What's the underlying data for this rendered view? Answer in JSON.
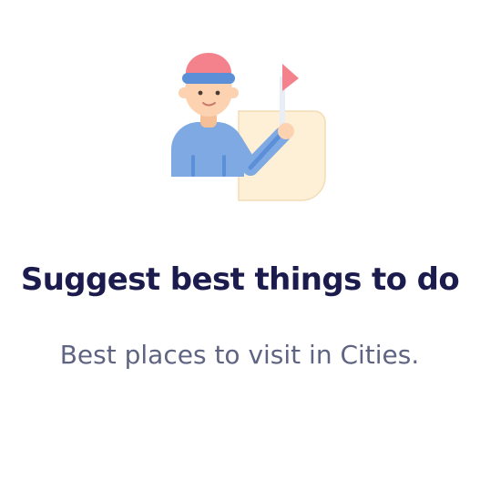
{
  "feature": {
    "illustration_icon": "tour-guide-with-flag-icon",
    "title": "Suggest best things to do",
    "description": "Best places to visit in Cities."
  },
  "colors": {
    "title": "#1c1b4d",
    "description": "#5f6483",
    "cap": "#f4828c",
    "cap_band": "#5b8fd8",
    "shirt": "#7fa9e2",
    "skin": "#fcd2b1",
    "map": "#fef0d6",
    "flag": "#f4828c"
  }
}
